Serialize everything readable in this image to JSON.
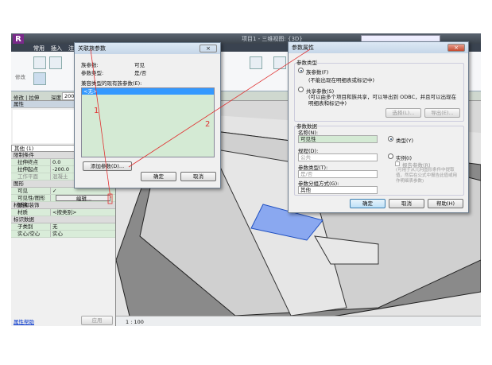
{
  "app": {
    "title": "项目1 - 三维视图: {3D}",
    "logo": "R",
    "tabs": [
      "常用",
      "插入",
      "注"
    ],
    "ribbon_modify": "修改"
  },
  "options_bar": {
    "mode": "修改 | 拉伸",
    "depth_label": "深度",
    "depth_value": "200.0"
  },
  "properties": {
    "title": "属性",
    "type_selector": "其他 (1)",
    "groups": [
      {
        "name": "限制条件",
        "rows": [
          {
            "label": "拉伸终点",
            "value": "0.0"
          },
          {
            "label": "拉伸起点",
            "value": "-200.0"
          },
          {
            "label": "工作平面",
            "value": "混凝土"
          }
        ]
      },
      {
        "name": "图形",
        "rows": [
          {
            "label": "可见",
            "value": "✓"
          },
          {
            "label": "可见性/图形替换",
            "value": "编辑..."
          }
        ]
      },
      {
        "name": "材质和装饰",
        "rows": [
          {
            "label": "材质",
            "value": "<按类别>"
          }
        ]
      },
      {
        "name": "标识数据",
        "rows": [
          {
            "label": "子类别",
            "value": "无"
          },
          {
            "label": "实心/空心",
            "value": "实心"
          }
        ]
      }
    ],
    "help_link": "属性帮助",
    "apply": "应用"
  },
  "status": {
    "scale": "1 : 100"
  },
  "dialog1": {
    "title": "关联族参数",
    "param_label": "族参数:",
    "param_value": "可见",
    "type_label": "参数类型:",
    "type_value": "是/否",
    "list_label": "兼容类型的现有族参数(E):",
    "items": [
      "<无>"
    ],
    "add_button": "添加参数(D)...",
    "ok": "确定",
    "cancel": "取消",
    "close": "×"
  },
  "dialog2": {
    "title": "参数属性",
    "close": "×",
    "type_group": "参数类型",
    "family_param": "族参数(F)",
    "family_note": "(不能出现在明细表或标记中)",
    "shared_param": "共享参数(S)",
    "shared_note": "(可以由多个项目和族共享，可以导出到 ODBC，并且可以出现在明细表和标记中)",
    "select_btn": "选择(L)...",
    "export_btn": "导出(E)...",
    "data_group": "参数数据",
    "name_label": "名称(N):",
    "name_value": "可见性",
    "discipline_label": "规程(D):",
    "discipline_value": "公共",
    "ptype_label": "参数类型(T):",
    "ptype_value": "是/否",
    "group_label": "参数分组方式(G):",
    "group_value": "其他",
    "type_radio": "类型(Y)",
    "instance_radio": "实例(I)",
    "report_param": "报告参数(R)",
    "report_note": "(可用于从几何图形条件中提取值，然后在公式中报告此值或用作明细表参数)",
    "ok": "确定",
    "cancel": "取消",
    "help": "帮助(H)"
  },
  "annotations": {
    "one": "1",
    "two": "2"
  },
  "colors": {
    "list_bg": "#d4ead4",
    "selection": "#3399ff",
    "annotation": "#e03030"
  }
}
